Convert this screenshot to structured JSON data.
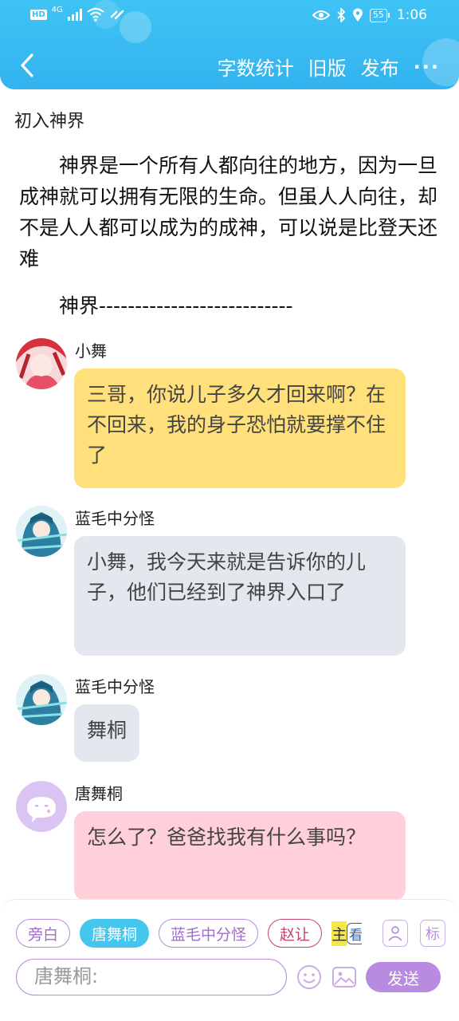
{
  "status_bar": {
    "hd": "HD",
    "network": "4G",
    "battery": "55",
    "time": "1:06"
  },
  "nav": {
    "word_count": "字数统计",
    "old_version": "旧版",
    "publish": "发布",
    "more": "···"
  },
  "story": {
    "chapter_title": "初入神界",
    "intro": "神界是一个所有人都向往的地方，因为一旦成神就可以拥有无限的生命。但虽人人向往，却不是人人都可以成为的成神，可以说是比登天还难",
    "divider": "神界---------------------------"
  },
  "messages": [
    {
      "sender": "小舞",
      "text": "三哥，你说儿子多久才回来啊？在不回来，我的身子恐怕就要撑不住了",
      "bubble_color": "#ffe07a"
    },
    {
      "sender": "蓝毛中分怪",
      "text": "小舞，我今天来就是告诉你的儿子，他们已经到了神界入口了",
      "bubble_color": "#e3e7ee"
    },
    {
      "sender": "蓝毛中分怪",
      "text": "舞桐",
      "bubble_color": "#e3e7ee"
    },
    {
      "sender": "唐舞桐",
      "text": "怎么了？爸爸找我有什么事吗？",
      "bubble_color": "#ffd0da"
    }
  ],
  "composer": {
    "roles": [
      "旁白",
      "唐舞桐",
      "蓝毛中分怪",
      "赵让"
    ],
    "active_role": "唐舞桐",
    "extra_chip_a": "主",
    "extra_chip_b": "看",
    "tag_label": "标",
    "input_value": "唐舞桐:",
    "send_label": "发送"
  },
  "icons": {
    "back": "chevron-left-icon",
    "role_manager": "person-card-icon",
    "emoji": "smiley-icon",
    "image": "image-icon"
  },
  "colors": {
    "header": "#3bbcf2",
    "accent_purple": "#b98ad8",
    "active_role": "#45c6ee"
  }
}
